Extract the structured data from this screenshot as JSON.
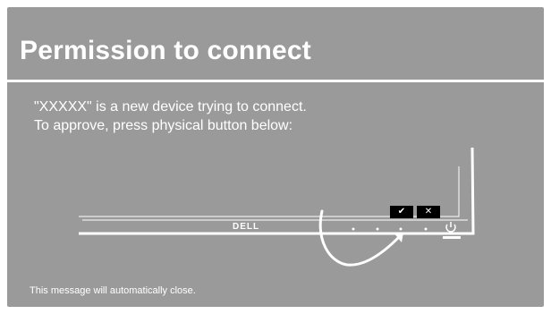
{
  "dialog": {
    "title": "Permission to connect",
    "message_line1": "\"XXXXX\" is a new device trying to connect.",
    "message_line2": "To approve, press physical button below:",
    "footer": "This message will automatically close."
  },
  "monitor": {
    "brand_logo": "DELL",
    "approve_label": "✔",
    "reject_label": "✕",
    "icons": [
      "check-icon",
      "close-icon",
      "power-icon",
      "curved-arrow-icon"
    ]
  },
  "colors": {
    "dialog_bg": "#9a9a9b",
    "text": "#ffffff",
    "label_bg": "#000000"
  }
}
